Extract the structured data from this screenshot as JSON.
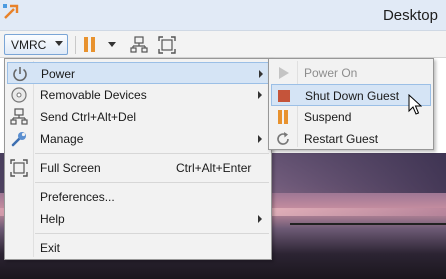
{
  "window": {
    "title": "Desktop"
  },
  "toolbar": {
    "vmrc_label": "VMRC",
    "icons": [
      "pause-icon",
      "dropdown-arrow-icon",
      "network-icon",
      "fullscreen-icon"
    ]
  },
  "menu": {
    "items": [
      {
        "label": "Power",
        "icon": "power-icon",
        "submenu": true,
        "highlighted": true
      },
      {
        "label": "Removable Devices",
        "icon": "disc-icon",
        "submenu": true
      },
      {
        "label": "Send Ctrl+Alt+Del",
        "icon": "network-icon"
      },
      {
        "label": "Manage",
        "icon": "wrench-icon",
        "submenu": true
      },
      {
        "label": "Full Screen",
        "icon": "fullscreen-icon",
        "shortcut": "Ctrl+Alt+Enter"
      },
      {
        "label": "Preferences..."
      },
      {
        "label": "Help",
        "submenu": true
      },
      {
        "label": "Exit"
      }
    ]
  },
  "power_submenu": {
    "items": [
      {
        "label": "Power On",
        "icon": "play-icon",
        "disabled": true
      },
      {
        "label": "Shut Down Guest",
        "icon": "stop-icon",
        "highlighted": true
      },
      {
        "label": "Suspend",
        "icon": "pause-icon"
      },
      {
        "label": "Restart Guest",
        "icon": "restart-icon"
      }
    ]
  },
  "colors": {
    "accent": "#e8822a",
    "highlight_bg": "#d5e4f5",
    "highlight_border": "#9bbfe6",
    "stop_red": "#c5543a",
    "titlebar_bg": "#e1eaf6"
  }
}
